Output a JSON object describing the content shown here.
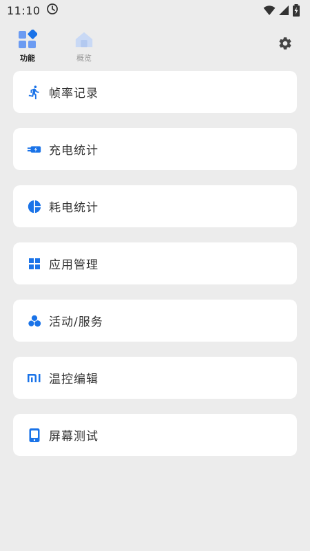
{
  "status_bar": {
    "time": "11:10",
    "icons": [
      "clock-icon",
      "wifi-icon",
      "signal-icon",
      "battery-charging-icon"
    ]
  },
  "nav": {
    "tabs": [
      {
        "label": "功能",
        "icon": "apps-grid-icon",
        "active": true
      },
      {
        "label": "概览",
        "icon": "home-icon",
        "active": false
      }
    ],
    "settings_icon": "gear-icon"
  },
  "colors": {
    "accent": "#1a73e8",
    "background": "#ececec",
    "card": "#ffffff"
  },
  "menu": {
    "items": [
      {
        "label": "帧率记录",
        "icon": "running-icon"
      },
      {
        "label": "充电统计",
        "icon": "charging-plug-icon"
      },
      {
        "label": "耗电统计",
        "icon": "pie-chart-icon"
      },
      {
        "label": "应用管理",
        "icon": "grid-icon"
      },
      {
        "label": "活动/服务",
        "icon": "bubbles-icon"
      },
      {
        "label": "温控编辑",
        "icon": "mi-logo-icon"
      },
      {
        "label": "屏幕测试",
        "icon": "phone-screen-icon"
      }
    ]
  }
}
